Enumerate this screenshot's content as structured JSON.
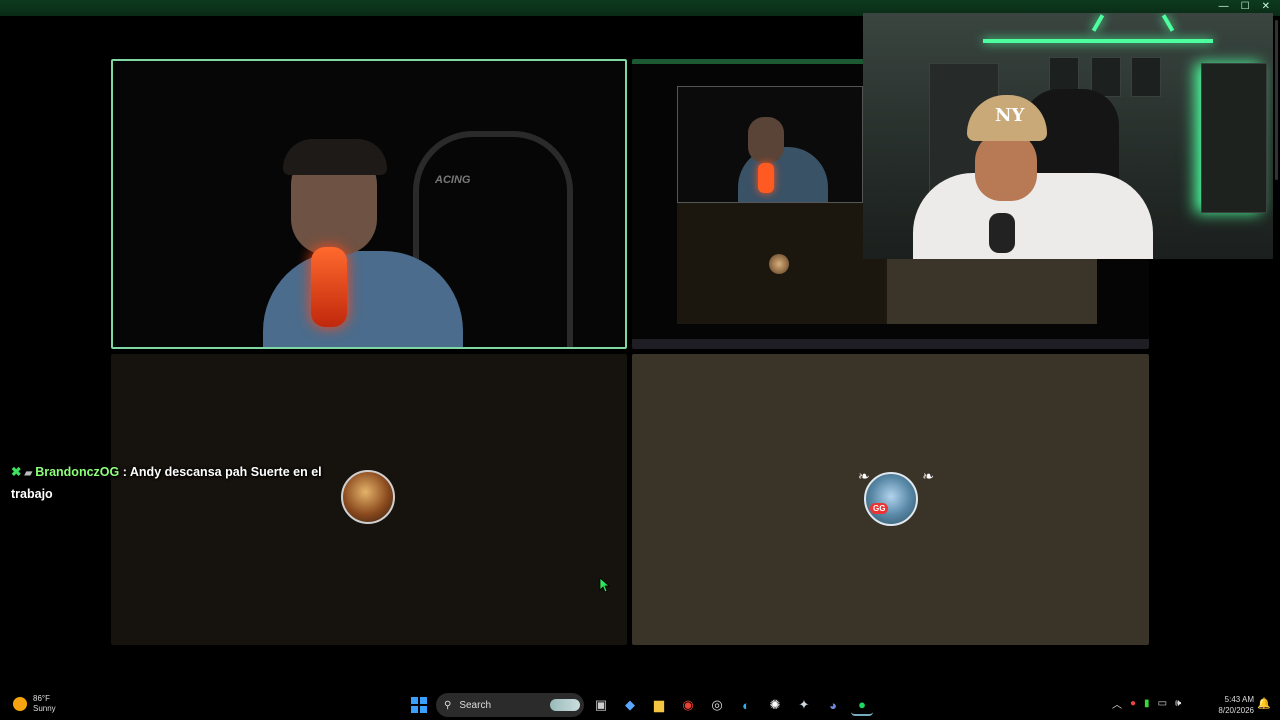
{
  "window": {
    "minimize": "—",
    "maximize": "☐",
    "close": "✕"
  },
  "tile1": {
    "chair_text": "ACING"
  },
  "chat": {
    "username": "BrandonczOG",
    "separator": " : ",
    "message": "Andy descansa pah Suerte en el trabajo"
  },
  "taskbar": {
    "weather": {
      "temp": "86°F",
      "condition": "Sunny"
    },
    "search_placeholder": "Search",
    "time": "5:43 AM",
    "date": "8/20/2026",
    "apps": [
      {
        "name": "task-view-icon",
        "glyph": "▣",
        "color": "#cccccc"
      },
      {
        "name": "copilot-icon",
        "glyph": "◆",
        "color": "#5aa7ff"
      },
      {
        "name": "file-explorer-icon",
        "glyph": "▆",
        "color": "#f4c542"
      },
      {
        "name": "chrome-icon",
        "glyph": "◉",
        "color": "#e94235"
      },
      {
        "name": "clock-app-icon",
        "glyph": "◎",
        "color": "#dddddd"
      },
      {
        "name": "edge-icon",
        "glyph": "◐",
        "color": "#2fb1e8"
      },
      {
        "name": "obs-icon",
        "glyph": "✺",
        "color": "#ffffff"
      },
      {
        "name": "steam-icon",
        "glyph": "✦",
        "color": "#cfd8e0"
      },
      {
        "name": "discord-icon",
        "glyph": "◕",
        "color": "#7289da"
      },
      {
        "name": "spotify-icon",
        "glyph": "●",
        "color": "#1ed760"
      }
    ]
  },
  "colors": {
    "accent": "#7fd8a4",
    "neon": "#4dff9e",
    "chat_user": "#8dff7a"
  }
}
